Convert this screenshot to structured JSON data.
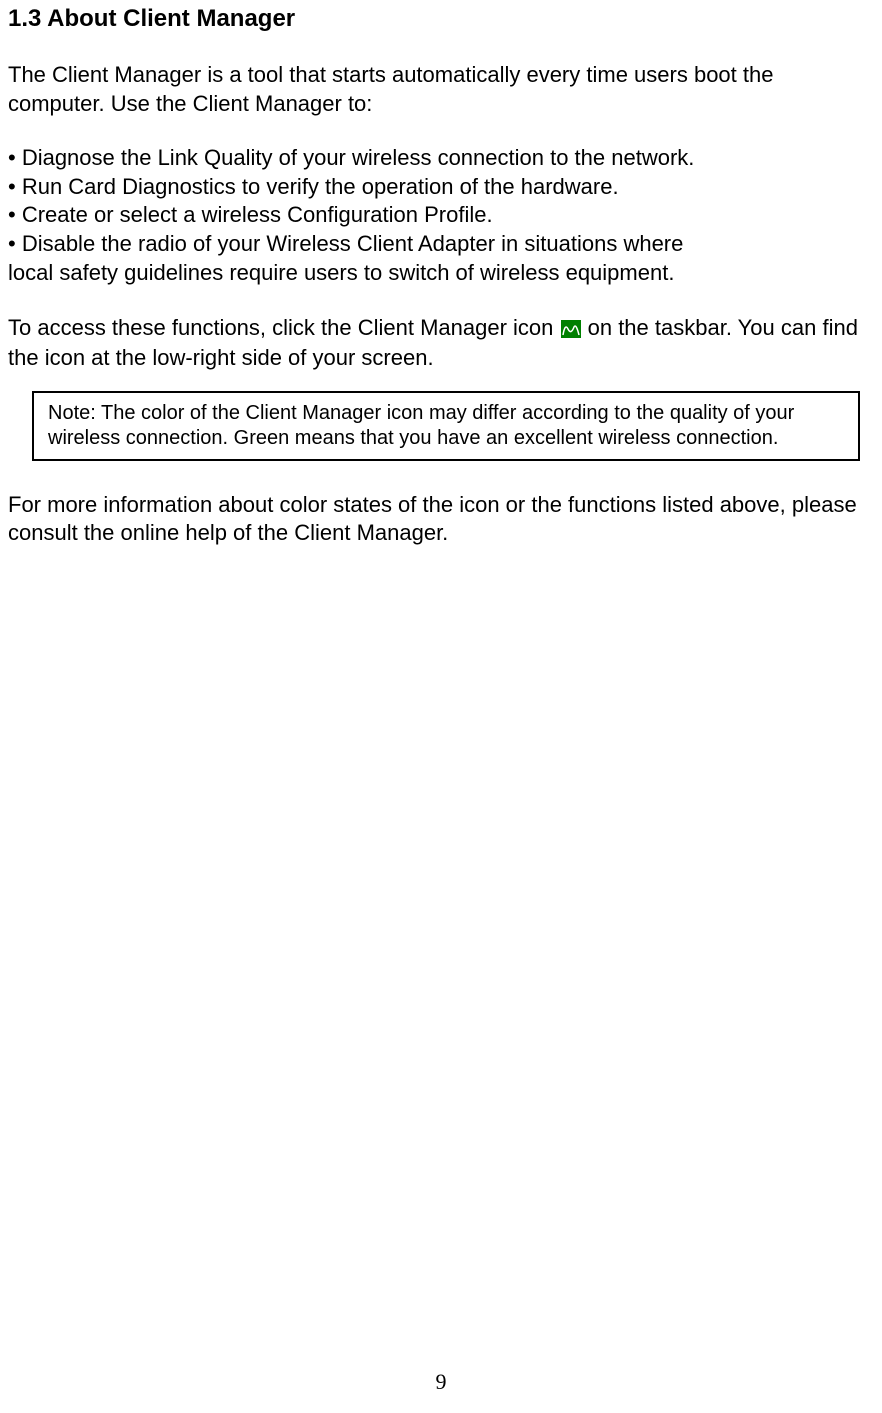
{
  "section": {
    "heading": "1.3  About Client Manager",
    "intro": "The Client Manager is a tool that starts automatically every time users boot the computer. Use the Client Manager to:",
    "bullets": [
      "• Diagnose the Link Quality of your wireless connection to the network.",
      "• Run Card Diagnostics to verify the operation of the hardware.",
      "• Create or select a wireless Configuration Profile.",
      "• Disable the radio of your Wireless Client Adapter in situations where",
      "local safety guidelines require users to switch of wireless equipment."
    ],
    "access_before": "To access these functions, click the Client Manager icon ",
    "access_after": " on the taskbar. You can find the icon at the low-right side of your screen.",
    "note": "Note: The color of the Client Manager icon may differ according to the quality of your wireless connection. Green means that you have an excellent wireless connection.",
    "closing": "For more information about color states of the icon or the functions listed above, please consult the online help of the Client Manager."
  },
  "page_number": "9"
}
